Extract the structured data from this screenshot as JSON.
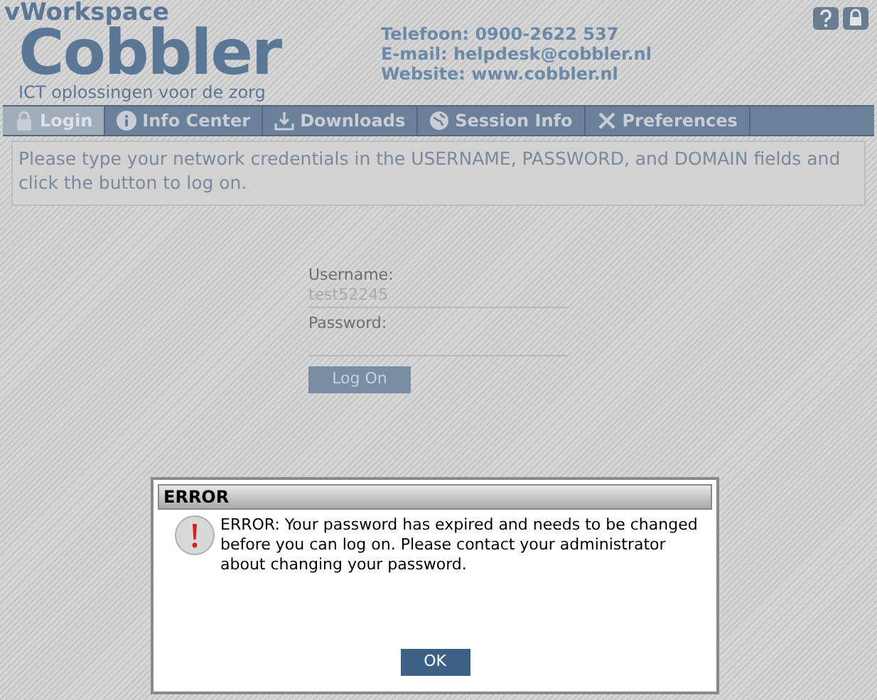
{
  "header": {
    "product": "vWorkspace",
    "brand": "Cobbler",
    "tagline": "ICT oplossingen voor de zorg",
    "contact": [
      "Telefoon: 0900-2622 537",
      "E-mail: helpdesk@cobbler.nl",
      "Website: www.cobbler.nl"
    ]
  },
  "tabs": [
    {
      "label": "Login",
      "kind": "lock",
      "selected": true
    },
    {
      "label": "Info Center",
      "kind": "info",
      "selected": false
    },
    {
      "label": "Downloads",
      "kind": "download",
      "selected": false
    },
    {
      "label": "Session Info",
      "kind": "session",
      "selected": false
    },
    {
      "label": "Preferences",
      "kind": "tools",
      "selected": false
    }
  ],
  "instructions": "Please type your network credentials in the USERNAME, PASSWORD, and DOMAIN fields and click the button to log on.",
  "form": {
    "username_label": "Username:",
    "username_value": "test52245",
    "password_label": "Password:",
    "button": "Log On"
  },
  "dialog": {
    "title": "ERROR",
    "message": "ERROR: Your password has expired and needs to be changed before you can log on. Please contact your administrator about changing your password.",
    "button": "OK"
  }
}
